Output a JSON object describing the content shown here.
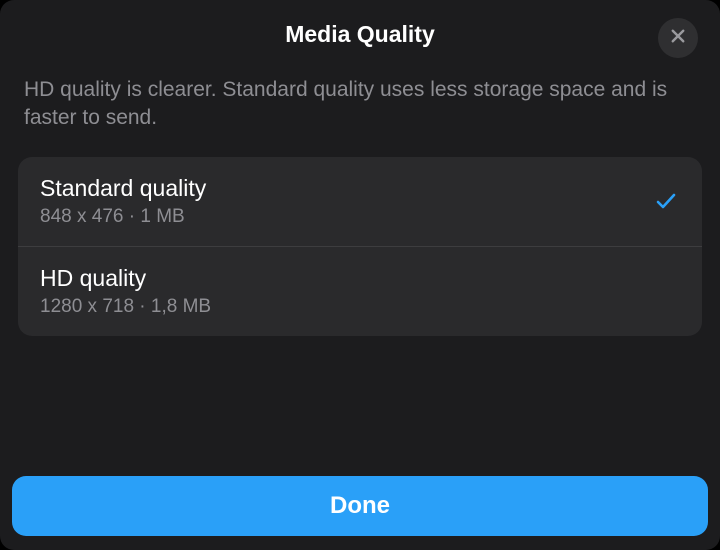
{
  "header": {
    "title": "Media Quality"
  },
  "description": "HD quality is clearer. Standard quality uses less storage space and is faster to send.",
  "options": [
    {
      "label": "Standard quality",
      "detail": "848 x 476 · 1 MB",
      "selected": true
    },
    {
      "label": "HD quality",
      "detail": "1280 x 718 · 1,8 MB",
      "selected": false
    }
  ],
  "buttons": {
    "done": "Done"
  },
  "colors": {
    "accent": "#2aa0f8",
    "checkmark": "#2aa0f8"
  }
}
